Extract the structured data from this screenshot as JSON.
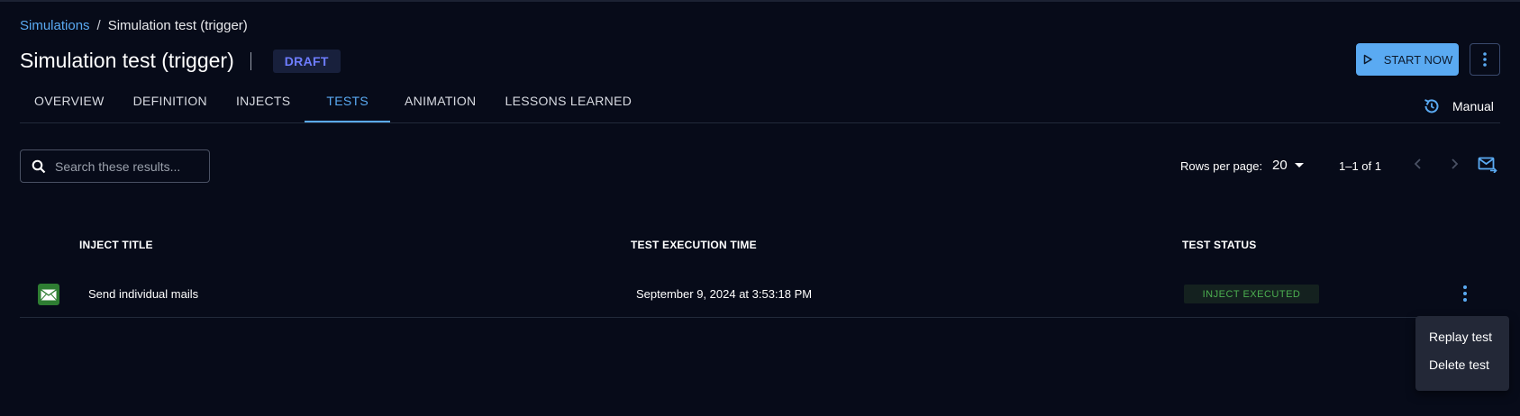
{
  "breadcrumb": {
    "parent": "Simulations",
    "separator": "/",
    "current": "Simulation test (trigger)"
  },
  "header": {
    "title": "Simulation test (trigger)",
    "status_badge": "DRAFT",
    "start_label": "START NOW"
  },
  "tabs": [
    {
      "label": "OVERVIEW",
      "active": false
    },
    {
      "label": "DEFINITION",
      "active": false
    },
    {
      "label": "INJECTS",
      "active": false
    },
    {
      "label": "TESTS",
      "active": true
    },
    {
      "label": "ANIMATION",
      "active": false
    },
    {
      "label": "LESSONS LEARNED",
      "active": false
    }
  ],
  "mode": {
    "label": "Manual",
    "icon": "refresh-icon"
  },
  "search": {
    "placeholder": "Search these results..."
  },
  "pagination": {
    "rows_label": "Rows per page:",
    "rows_value": "20",
    "range": "1–1 of 1"
  },
  "table": {
    "headers": [
      "INJECT TITLE",
      "TEST EXECUTION TIME",
      "TEST STATUS"
    ],
    "rows": [
      {
        "icon": "mail-icon",
        "title": "Send individual mails",
        "time": "September 9, 2024 at 3:53:18 PM",
        "status": "INJECT EXECUTED"
      }
    ]
  },
  "context_menu": {
    "items": [
      "Replay test",
      "Delete test"
    ]
  },
  "colors": {
    "accent": "#5aaaf2",
    "background": "#070b19",
    "draft": "#6e7dff",
    "success": "#4caf50"
  }
}
